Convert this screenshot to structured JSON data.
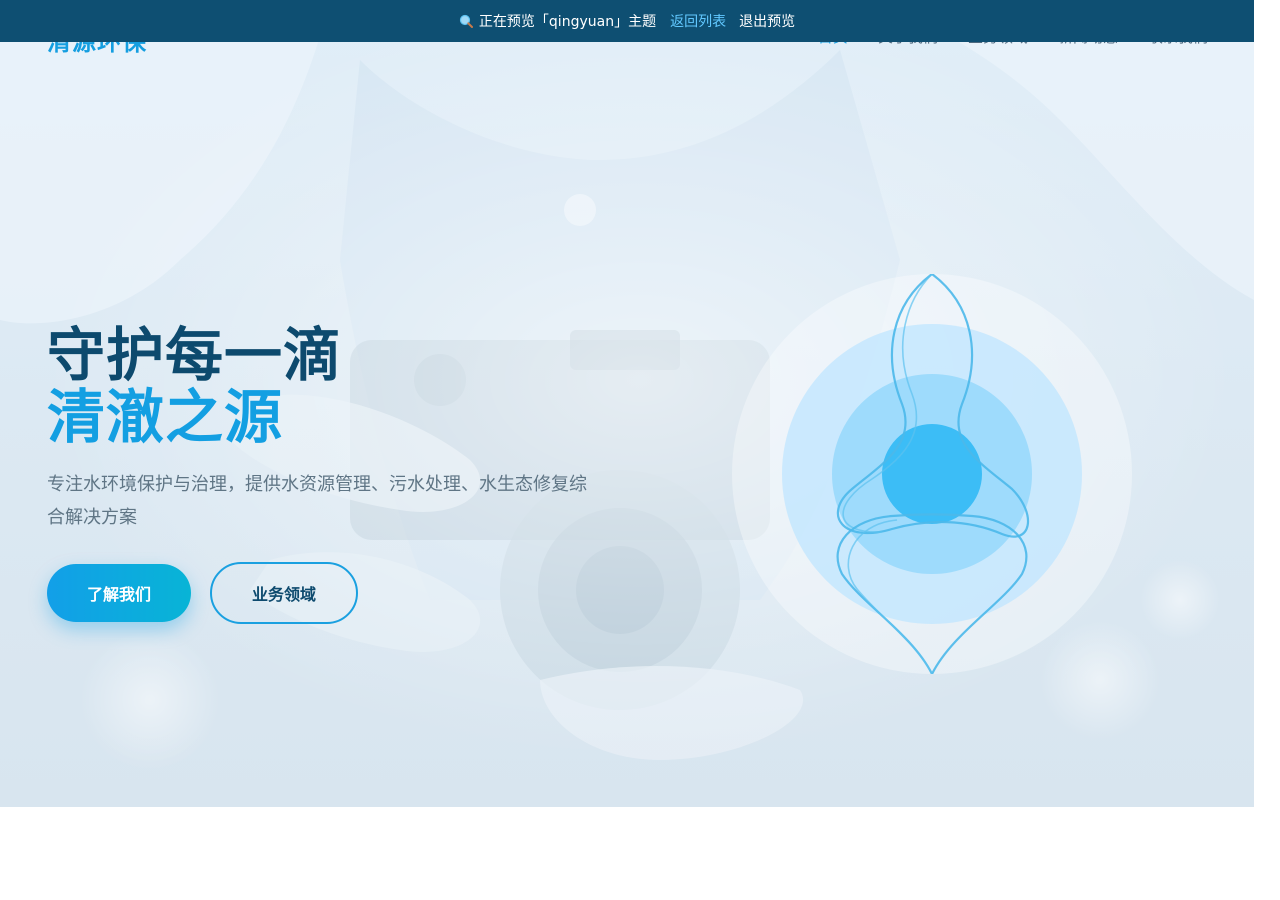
{
  "preview_bar": {
    "status_text": "正在预览「qingyuan」主题",
    "back_label": "返回列表",
    "exit_label": "退出预览",
    "icon": "magnifier-icon",
    "background": "#0e4f72",
    "link_color": "#61c8ff"
  },
  "header": {
    "logo": "清源环保",
    "nav": [
      "首页",
      "关于我们",
      "业务领域",
      "新闻动态",
      "联系我们"
    ],
    "active_index": 0
  },
  "hero": {
    "title_line1": "守护每一滴",
    "title_line2": "清澈之源",
    "description": "专注水环境保护与治理，提供水资源管理、污水处理、水生态修复综合解决方案",
    "primary_button": "了解我们",
    "secondary_button": "业务领域",
    "graphic_icon": "water-drop-icon"
  },
  "colors": {
    "brand_blue": "#139fe2",
    "dark_navy": "#0d4a6e",
    "text_muted": "#5f7585"
  }
}
